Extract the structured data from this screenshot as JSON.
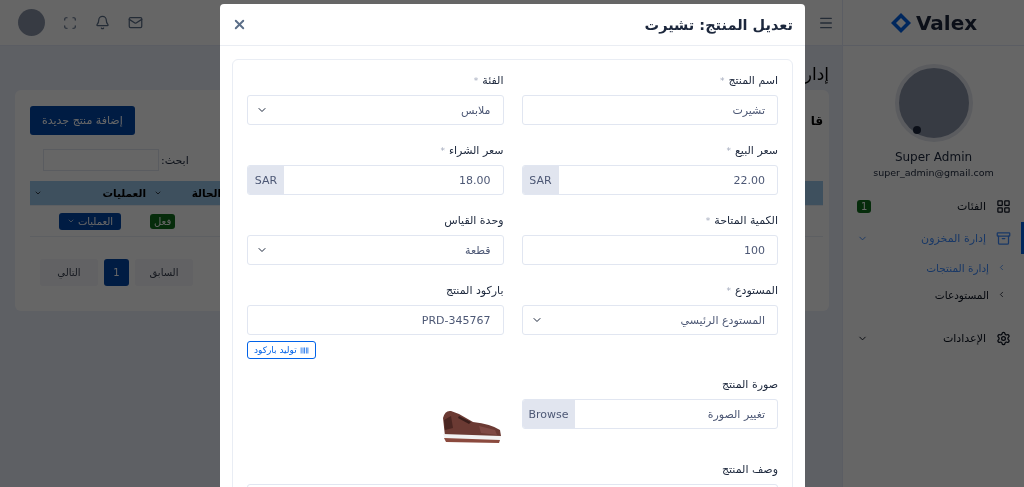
{
  "sidebar": {
    "logo": "Valex",
    "user": {
      "name": "Super Admin",
      "email": "super_admin@gmail.com"
    },
    "items": [
      {
        "kind": "link",
        "label": "الفئات",
        "badge": "1",
        "selected": false
      },
      {
        "kind": "group",
        "label": "إدارة المخزون",
        "selected": true,
        "children": [
          {
            "label": "إدارة المنتجات",
            "selected": true
          },
          {
            "label": "المستودعات",
            "selected": false
          }
        ]
      },
      {
        "kind": "group",
        "label": "الإعدادات",
        "selected": false
      }
    ]
  },
  "page": {
    "title": "إدار",
    "card_title": "قا",
    "add_button": "إضافة منتج جديدة",
    "search_label": "ابحث:",
    "table": {
      "columns": [
        "الحالة",
        "العمليات"
      ],
      "rows": [
        {
          "status": "فعل",
          "actions": "العمليات"
        }
      ]
    },
    "pagination": [
      {
        "label": "السابق",
        "selected": false
      },
      {
        "label": "1",
        "selected": true
      },
      {
        "label": "التالي",
        "selected": false
      }
    ]
  },
  "modal": {
    "title": "تعديل المنتج: تشيرت",
    "fields": [
      {
        "kind": "text",
        "label": "اسم المنتج",
        "mark": "*",
        "value": "تشيرت"
      },
      {
        "kind": "select",
        "label": "الفئة",
        "mark": "*",
        "value": "ملابس"
      },
      {
        "kind": "currency",
        "label": "سعر البيع",
        "mark": "*",
        "value": "22.00",
        "addon": "SAR"
      },
      {
        "kind": "currency",
        "label": "سعر الشراء",
        "mark": "*",
        "value": "18.00",
        "addon": "SAR"
      },
      {
        "kind": "text",
        "label": "الكمية المتاحة",
        "mark": "*",
        "value": "100"
      },
      {
        "kind": "select",
        "label": "وحدة القياس",
        "value": "قطعة"
      },
      {
        "kind": "select",
        "label": "المستودع",
        "mark": "*",
        "value": "المستودع الرئيسي"
      },
      {
        "kind": "text",
        "label": "باركود المنتج",
        "value": "PRD-345767",
        "action": "توليد باركود"
      },
      {
        "kind": "file",
        "label": "صورة المنتج",
        "value": "تغيير الصورة",
        "addon": "Browse"
      },
      {
        "kind": "picture"
      },
      {
        "kind": "textarea",
        "label": "وصف المنتج"
      }
    ]
  }
}
